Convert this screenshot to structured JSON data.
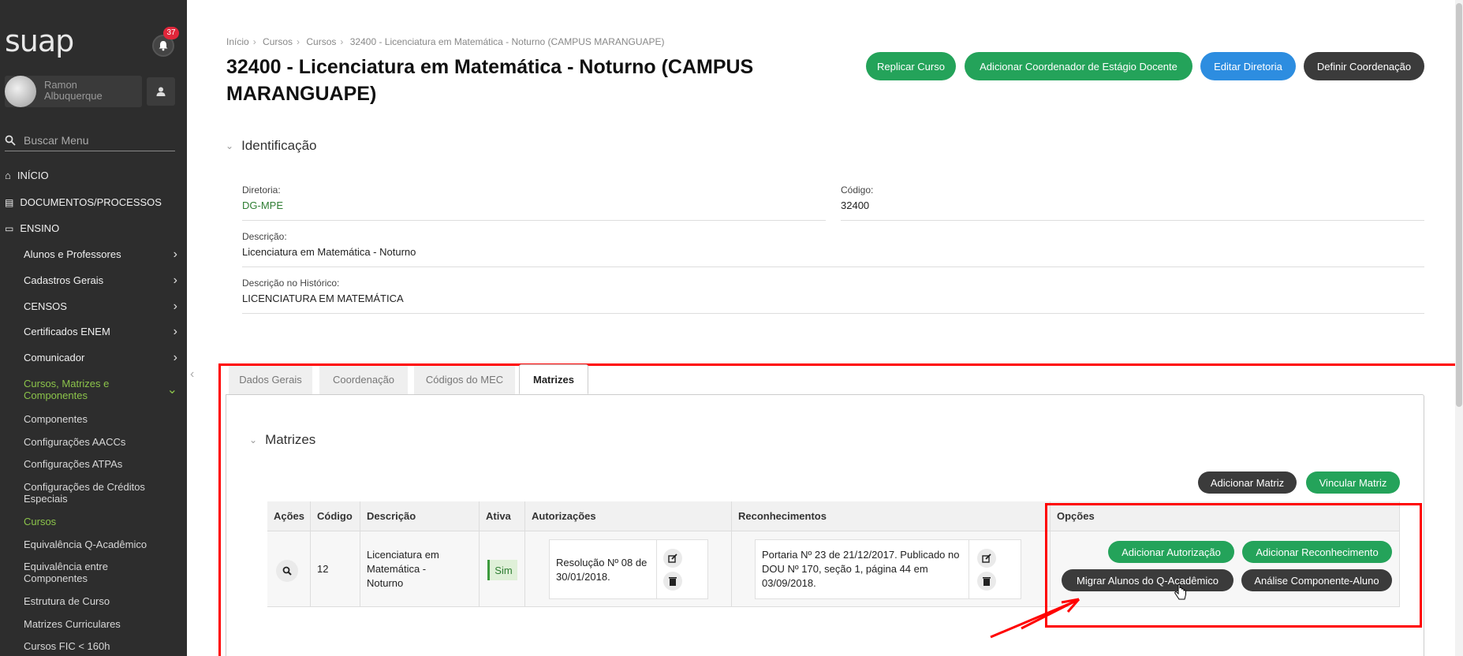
{
  "sidebar": {
    "logo": "suap",
    "notification_count": "37",
    "user_name": "Ramon Albuquerque",
    "search_placeholder": "Buscar Menu",
    "top_items": [
      "INÍCIO",
      "DOCUMENTOS/PROCESSOS",
      "ENSINO"
    ],
    "ensino_items": [
      "Alunos e Professores",
      "Cadastros Gerais",
      "CENSOS",
      "Certificados ENEM",
      "Comunicador",
      "Cursos, Matrizes e Componentes"
    ],
    "sub_items": [
      "Componentes",
      "Configurações AACCs",
      "Configurações ATPAs",
      "Configurações de Créditos Especiais",
      "Cursos",
      "Equivalência Q-Acadêmico",
      "Equivalência entre Componentes",
      "Estrutura de Curso",
      "Matrizes Curriculares",
      "Cursos FIC < 160h"
    ]
  },
  "breadcrumb": [
    "Início",
    "Cursos",
    "Cursos",
    "32400 - Licenciatura em Matemática - Noturno (CAMPUS MARANGUAPE)"
  ],
  "page_title": "32400 - Licenciatura em Matemática - Noturno (CAMPUS MARANGUAPE)",
  "header_buttons": [
    "Replicar Curso",
    "Adicionar Coordenador de Estágio Docente",
    "Editar Diretoria",
    "Definir Coordenação"
  ],
  "identificacao": {
    "title": "Identificação",
    "diretoria_label": "Diretoria:",
    "diretoria_value": "DG-MPE",
    "codigo_label": "Código:",
    "codigo_value": "32400",
    "descricao_label": "Descrição:",
    "descricao_value": "Licenciatura em Matemática - Noturno",
    "historico_label": "Descrição no Histórico:",
    "historico_value": "LICENCIATURA EM MATEMÁTICA"
  },
  "tabs": [
    "Dados Gerais",
    "Coordenação",
    "Códigos do MEC",
    "Matrizes"
  ],
  "matrizes": {
    "title": "Matrizes",
    "buttons": [
      "Adicionar Matriz",
      "Vincular Matriz"
    ],
    "columns": [
      "Ações",
      "Código",
      "Descrição",
      "Ativa",
      "Autorizações",
      "Reconhecimentos",
      "Opções"
    ],
    "row": {
      "codigo": "12",
      "descricao": "Licenciatura em Matemática - Noturno",
      "ativa": "Sim",
      "autorizacao": "Resolução Nº 08 de 30/01/2018.",
      "reconhecimento": "Portaria Nº 23 de 21/12/2017. Publicado no DOU Nº 170, seção 1, página 44 em 03/09/2018."
    },
    "option_buttons": [
      "Adicionar Autorização",
      "Adicionar Reconhecimento",
      "Migrar Alunos do Q-Acadêmico",
      "Análise Componente-Aluno"
    ]
  },
  "colors": {
    "sidebar_bg": "#2d2d2d",
    "accent_green": "#24a35a",
    "accent_blue": "#2d8de0",
    "dark_button": "#3b3b3b",
    "annotation_red": "#ff0000",
    "menu_active": "#8bc34a"
  },
  "icons": [
    "bell-icon",
    "user-icon",
    "search-icon",
    "home-icon",
    "document-icon",
    "ensino-icon",
    "chevron-right-icon",
    "chevron-down-icon",
    "magnifier-icon",
    "edit-icon",
    "trash-icon",
    "cursor-hand-icon"
  ]
}
